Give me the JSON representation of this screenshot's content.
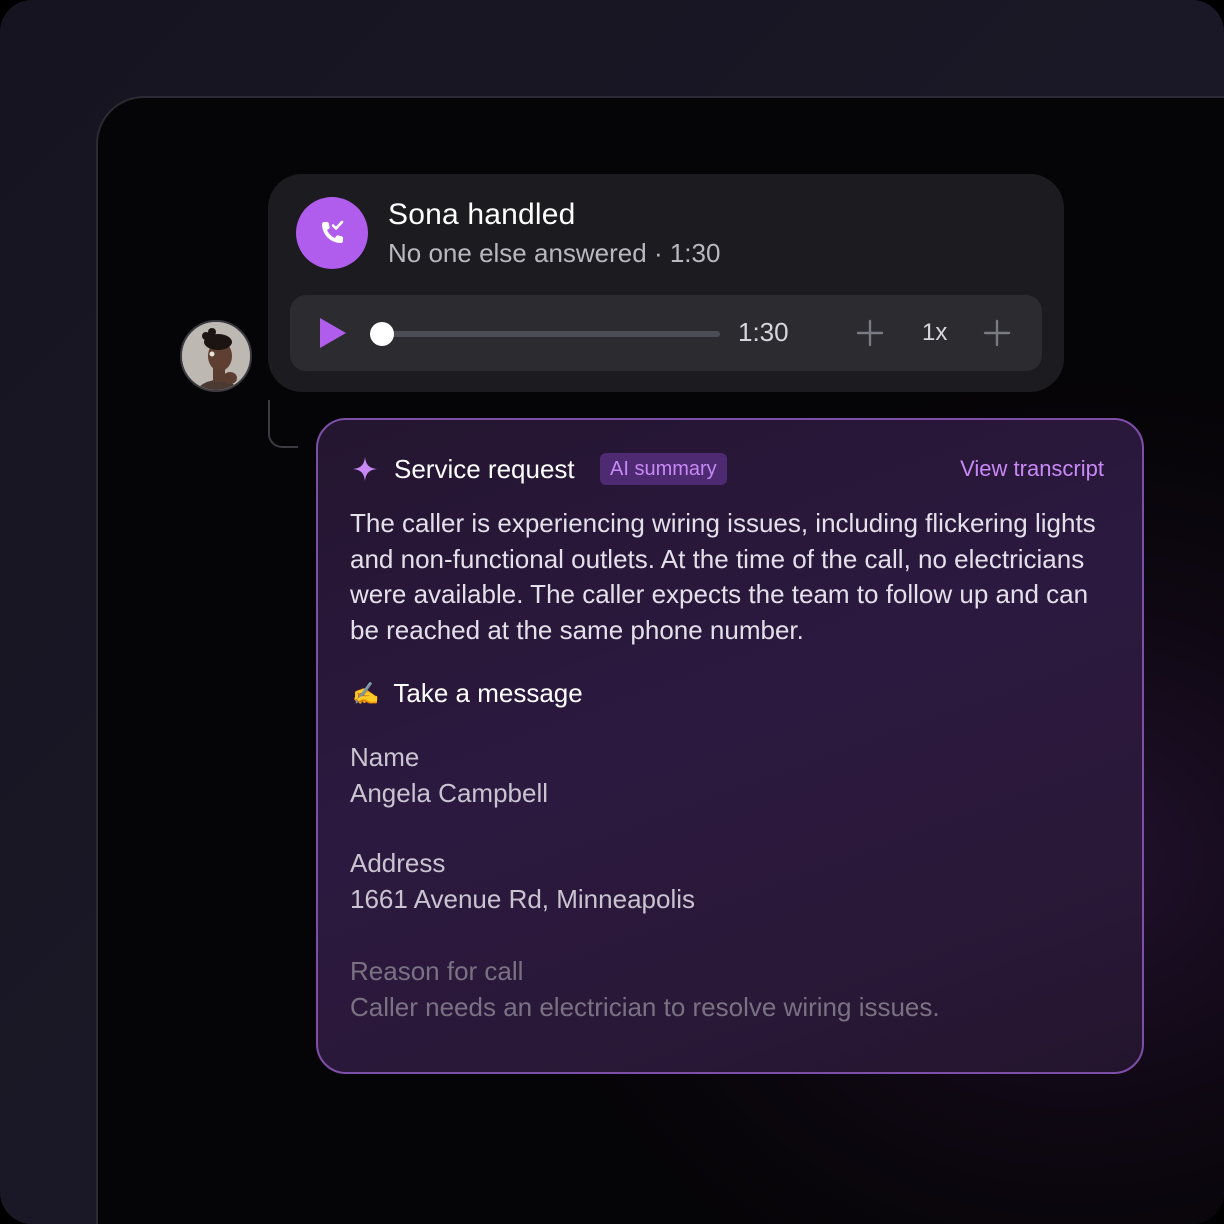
{
  "call": {
    "title": "Sona handled",
    "subtitle": "No one else answered · 1:30",
    "player": {
      "time": "1:30",
      "speed": "1x",
      "progress": 0.0
    }
  },
  "summary": {
    "title": "Service request",
    "badge": "AI summary",
    "view_transcript": "View transcript",
    "text": "The caller is experiencing wiring issues, including flickering lights and non-functional outlets. At the time of the call, no electricians were available. The caller expects the team to follow up and can be reached at the same phone number."
  },
  "message": {
    "icon": "✍️",
    "title": "Take a message",
    "fields": [
      {
        "label": "Name",
        "value": "Angela Campbell"
      },
      {
        "label": "Address",
        "value": "1661 Avenue Rd, Minneapolis"
      },
      {
        "label": "Reason for call",
        "value": "Caller needs an electrician to resolve wiring issues."
      }
    ]
  },
  "colors": {
    "accent": "#b05ced",
    "accent_text": "#c889f5",
    "card_border": "#7e4fa8"
  },
  "icons": {
    "call_status": "phone-check-icon",
    "play": "play-icon",
    "sparkle": "sparkle-icon",
    "rewind": "plus-icon",
    "forward": "plus-icon"
  }
}
